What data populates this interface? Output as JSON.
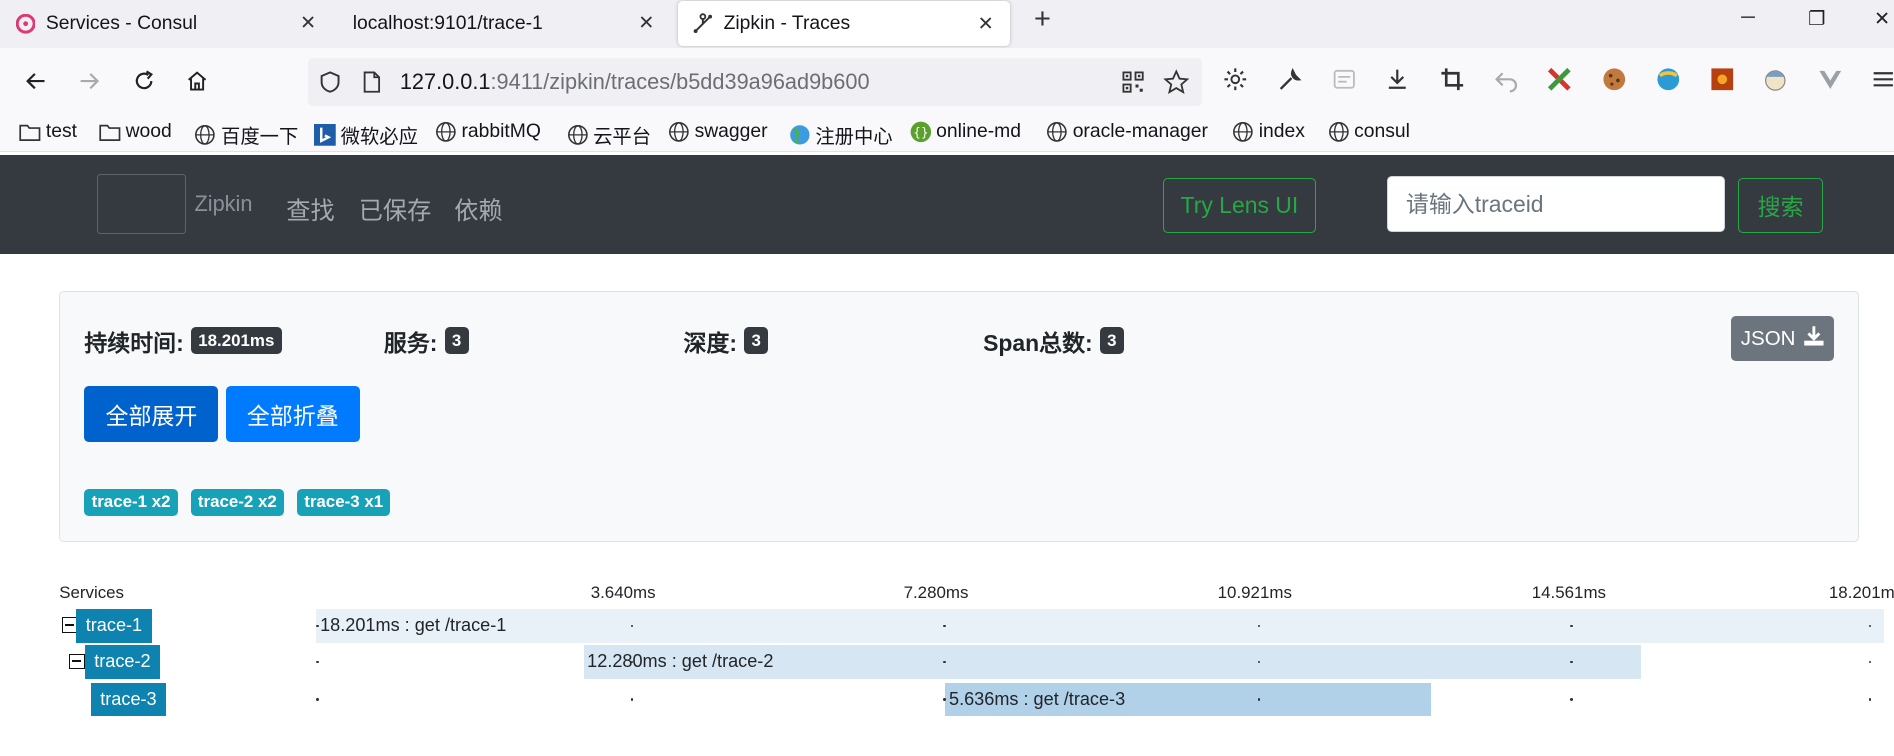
{
  "tabs": [
    {
      "title": "Services - Consul",
      "close": "✕"
    },
    {
      "title": "localhost:9101/trace-1",
      "close": "✕"
    },
    {
      "title": "Zipkin - Traces",
      "close": "✕"
    }
  ],
  "new_tab": "+",
  "window_controls": {
    "minimize": "─",
    "restore": "❐",
    "close": "✕"
  },
  "address_bar": {
    "host": "127.0.0.1",
    "rest": ":9411/zipkin/traces/b5dd39a96ad9b600"
  },
  "bookmarks": [
    {
      "label": "test",
      "icon": "folder-icon"
    },
    {
      "label": "wood",
      "icon": "folder-icon"
    },
    {
      "label": "百度一下",
      "icon": "globe-icon"
    },
    {
      "label": "微软必应",
      "icon": "bing-icon"
    },
    {
      "label": "rabbitMQ",
      "icon": "globe-icon"
    },
    {
      "label": "云平台",
      "icon": "globe-icon"
    },
    {
      "label": "swagger",
      "icon": "globe-icon"
    },
    {
      "label": "注册中心",
      "icon": "earth-icon"
    },
    {
      "label": "online-md",
      "icon": "md-icon"
    },
    {
      "label": "oracle-manager",
      "icon": "globe-icon"
    },
    {
      "label": "index",
      "icon": "globe-icon"
    },
    {
      "label": "consul",
      "icon": "globe-icon"
    }
  ],
  "zipkin_header": {
    "brand": "Zipkin",
    "nav": [
      "查找",
      "已保存",
      "依赖"
    ],
    "lens_button": "Try Lens UI",
    "traceid_placeholder": "请输入traceid",
    "search_button": "搜索"
  },
  "summary": {
    "duration_label": "持续时间:",
    "duration_value": "18.201ms",
    "services_label": "服务:",
    "services_value": "3",
    "depth_label": "深度:",
    "depth_value": "3",
    "spans_label": "Span总数:",
    "spans_value": "3",
    "json_button": "JSON",
    "expand_all": "全部展开",
    "collapse_all": "全部折叠",
    "service_badges": [
      "trace-1 x2",
      "trace-2 x2",
      "trace-3 x1"
    ]
  },
  "timeline": {
    "services_header": "Services",
    "ticks": [
      "3.640ms",
      "7.280ms",
      "10.921ms",
      "14.561ms",
      "18.201ms"
    ],
    "spans": [
      {
        "service": "trace-1",
        "label": "18.201ms : get /trace-1",
        "start_ms": 0,
        "duration_ms": 18.201,
        "color": "#e8f1f8"
      },
      {
        "service": "trace-2",
        "label": "12.280ms : get /trace-2",
        "start_ms": 3.1,
        "duration_ms": 12.28,
        "color": "#d6e6f2"
      },
      {
        "service": "trace-3",
        "label": "5.636ms : get /trace-3",
        "start_ms": 7.3,
        "duration_ms": 5.636,
        "color": "#b1d1e9"
      }
    ]
  },
  "colors": {
    "header_bg": "#343a40",
    "success": "#28a745",
    "primary": "#007bff",
    "info": "#17a2b8",
    "service_label": "#0e83b0"
  }
}
